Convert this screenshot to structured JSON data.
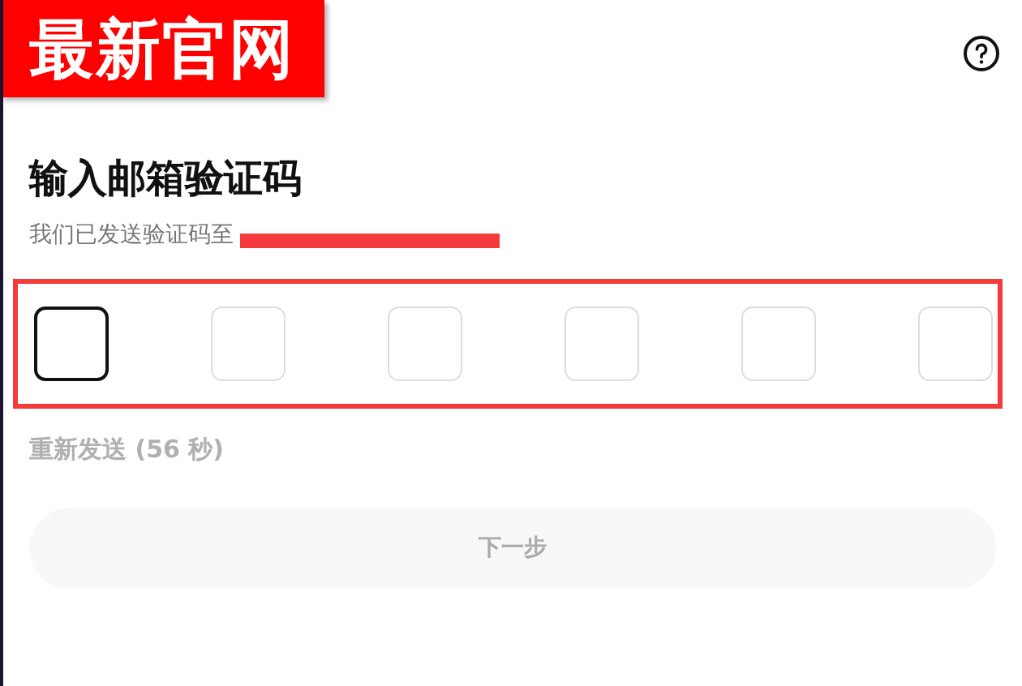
{
  "annotation_label": "最新官网",
  "title": "输入邮箱验证码",
  "subtitle": "我们已发送验证码至",
  "email_redacted": true,
  "code_boxes": [
    {
      "selected": true
    },
    {
      "selected": false
    },
    {
      "selected": false
    },
    {
      "selected": false
    },
    {
      "selected": false
    },
    {
      "selected": false
    }
  ],
  "code_highlight": true,
  "resend": {
    "label": "重新发送 (56 秒)",
    "disabled": true
  },
  "next_button": {
    "label": "下一步",
    "disabled": true
  }
}
